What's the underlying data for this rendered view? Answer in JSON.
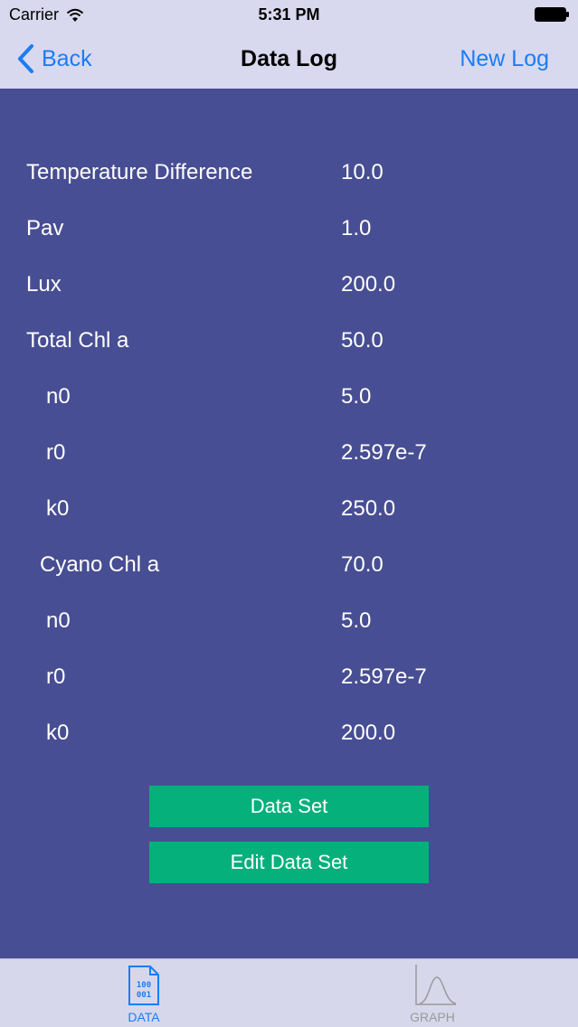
{
  "status": {
    "carrier": "Carrier",
    "time": "5:31 PM"
  },
  "nav": {
    "back_label": "Back",
    "title": "Data Log",
    "new_log_label": "New Log"
  },
  "rows": [
    {
      "label": "Temperature Difference",
      "value": "10.0"
    },
    {
      "label": "Pav",
      "value": "1.0"
    },
    {
      "label": "Lux",
      "value": "200.0"
    },
    {
      "label": "Total Chl a",
      "value": "50.0"
    },
    {
      "label": "n0",
      "value": "5.0"
    },
    {
      "label": "r0",
      "value": "2.597e-7"
    },
    {
      "label": "k0",
      "value": "250.0"
    },
    {
      "label": "Cyano Chl a",
      "value": "70.0"
    },
    {
      "label": "n0",
      "value": "5.0"
    },
    {
      "label": "r0",
      "value": "2.597e-7"
    },
    {
      "label": "k0",
      "value": "200.0"
    }
  ],
  "buttons": {
    "data_set": "Data Set",
    "edit_data_set": "Edit Data Set"
  },
  "tabs": [
    {
      "label": "DATA",
      "icon": "data-file-icon",
      "selected": true
    },
    {
      "label": "GRAPH",
      "icon": "graph-curve-icon",
      "selected": false
    }
  ],
  "colors": {
    "background": "#484e93",
    "accent": "#1a7cf6",
    "button": "#05b07a",
    "bar": "#d8d8ee"
  }
}
